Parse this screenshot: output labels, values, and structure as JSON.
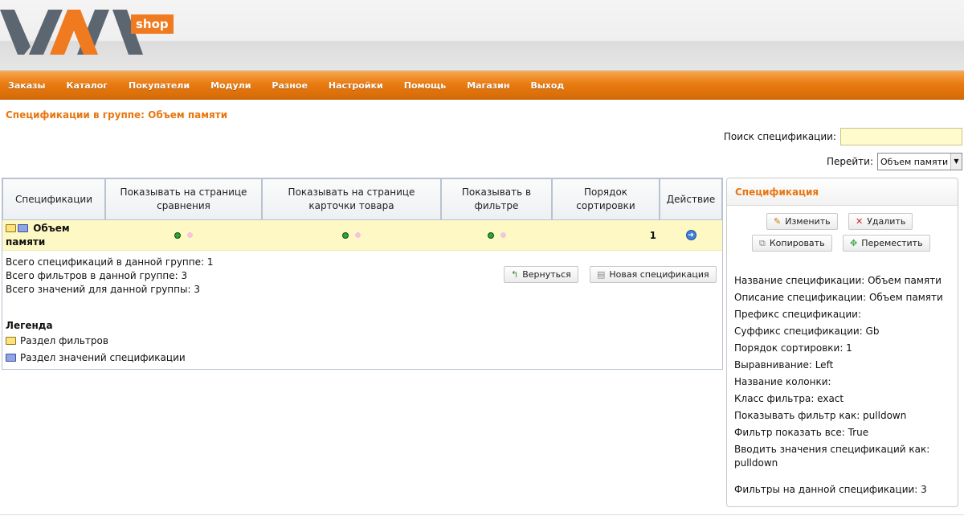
{
  "logo": {
    "text": "VAM",
    "badge": "shop"
  },
  "nav": [
    "Заказы",
    "Каталог",
    "Покупатели",
    "Модули",
    "Разное",
    "Настройки",
    "Помощь",
    "Магазин",
    "Выход"
  ],
  "page_title": "Спецификации в группе: Объем памяти",
  "search": {
    "label": "Поиск спецификации:",
    "value": ""
  },
  "goto": {
    "label": "Перейти:",
    "selected": "Объем памяти"
  },
  "table": {
    "headers": [
      "Спецификации",
      "Показывать на странице сравнения",
      "Показывать на странице карточки товара",
      "Показывать в фильтре",
      "Порядок сортировки",
      "Действие"
    ],
    "rows": [
      {
        "name": "Объем памяти",
        "sort": "1"
      }
    ]
  },
  "totals": [
    "Всего спецификаций в данной группе:  1",
    "Всего фильтров в данной группе:  3",
    "Всего значений для данной группы:  3"
  ],
  "buttons": {
    "back": "Вернуться",
    "new_spec": "Новая спецификация"
  },
  "legend": {
    "title": "Легенда",
    "items": [
      "Раздел фильтров",
      "Раздел значений спецификации"
    ]
  },
  "side": {
    "title": "Спецификация",
    "buttons": {
      "edit": "Изменить",
      "delete": "Удалить",
      "copy": "Копировать",
      "move": "Переместить"
    },
    "info": [
      "Название спецификации: Объем памяти",
      "Описание спецификации: Объем памяти",
      "Префикс спецификации:",
      "Суффикс спецификации: Gb",
      "Порядок сортировки: 1",
      "Выравнивание: Left",
      "Название колонки:",
      "Класс фильтра: exact",
      "Показывать фильтр как: pulldown",
      "Фильтр показать все: True",
      "Вводить значения спецификаций как: pulldown"
    ],
    "footer": "Фильтры на данной спецификации: 3"
  },
  "colors": {
    "accent": "#e8760f",
    "nav": "#e97b12",
    "highlight_row": "#fdf8c4",
    "search_bg": "#fffbcc"
  }
}
